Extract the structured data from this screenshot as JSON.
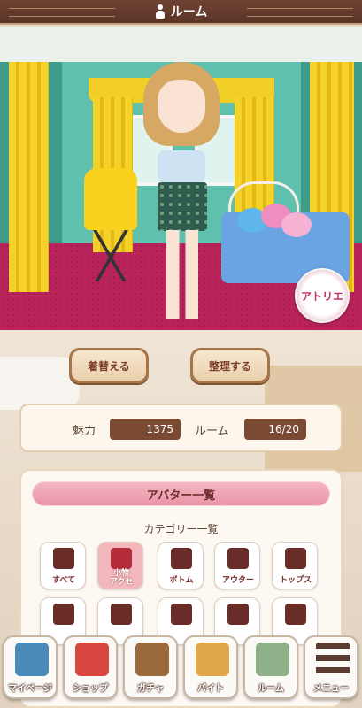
{
  "header": {
    "title": "ルーム"
  },
  "room": {
    "atelier_label": "アトリエ"
  },
  "actions": {
    "dress_up": "着替える",
    "organize": "整理する"
  },
  "stats": {
    "charm_label": "魅力",
    "charm_value": "1375",
    "room_label": "ルーム",
    "room_value": "16/20"
  },
  "avatar_list": {
    "title": "アバター一覧",
    "subtitle": "カテゴリー一覧",
    "categories": [
      {
        "label": "すべて",
        "icon": "all-clothes-icon"
      },
      {
        "label": "小物\nアクセ",
        "icon": "accessory-icon",
        "selected": true
      },
      {
        "label": "ボトム",
        "icon": "skirt-icon"
      },
      {
        "label": "アウター",
        "icon": "coat-icon"
      },
      {
        "label": "トップス",
        "icon": "shirt-icon"
      },
      {
        "label": "",
        "icon": "hair-icon"
      },
      {
        "label": "",
        "icon": "hat-icon"
      },
      {
        "label": "",
        "icon": "shoe-icon"
      },
      {
        "label": "",
        "icon": "body-icon"
      },
      {
        "label": "",
        "icon": "room-item-icon"
      }
    ]
  },
  "nav": {
    "items": [
      {
        "label": "マイページ",
        "icon": "house-icon"
      },
      {
        "label": "ショップ",
        "icon": "shop-icon"
      },
      {
        "label": "ガチャ",
        "icon": "gacha-icon"
      },
      {
        "label": "バイト",
        "icon": "job-icon"
      },
      {
        "label": "ルーム",
        "icon": "room-icon"
      },
      {
        "label": "メニュー",
        "icon": "menu-icon"
      }
    ]
  },
  "colors": {
    "header_bg": "#6f4333",
    "accent_pink": "#e993a6",
    "stat_bg": "#7a4a33"
  }
}
